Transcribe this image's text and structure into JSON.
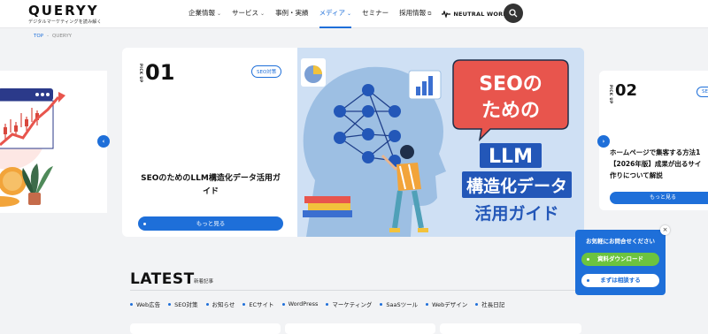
{
  "header": {
    "logo_name": "QUERYY",
    "logo_tagline": "デジタルマーケティングを読み解く",
    "nav": [
      {
        "label": "企業情報",
        "chevron": "⌄"
      },
      {
        "label": "サービス",
        "chevron": "⌄"
      },
      {
        "label": "事例・実績",
        "chevron": ""
      },
      {
        "label": "メディア",
        "chevron": "⌄"
      },
      {
        "label": "セミナー",
        "chevron": ""
      },
      {
        "label": "採用情報",
        "chevron": "⧉"
      }
    ],
    "neutral_works": "NEUTRAL WORKS"
  },
  "breadcrumb": {
    "top": "TOP",
    "separator": "-",
    "current": "QUERYY"
  },
  "pickup": {
    "main": {
      "up_label": "PICK UP",
      "number": "01",
      "tag": "SEO対策",
      "title": "SEOのためのLLM構造化データ活用ガイド",
      "more": "もっと見る",
      "hero": {
        "bubble_line1": "SEOの",
        "bubble_line2": "ための",
        "box_line1": "LLM",
        "box_line2": "構造化データ",
        "box_line3": "活用ガイド"
      }
    },
    "next": {
      "up_label": "PICK UP",
      "number": "02",
      "tag": "SEO",
      "title_line1": "ホームページで集客する方法1",
      "title_line2": "【2026年版】成果が出るサイ",
      "title_line3": "作りについて解説",
      "more": "もっと見る"
    },
    "prev_arrow": "‹",
    "next_arrow": "›"
  },
  "latest": {
    "heading": "LATEST",
    "sub": "新着記事",
    "categories": [
      "Web広告",
      "SEO対策",
      "お知らせ",
      "ECサイト",
      "WordPress",
      "マーケティング",
      "SaaSツール",
      "Webデザイン",
      "社長日記"
    ]
  },
  "contact": {
    "title": "お気軽にお問合せください",
    "download": "資料ダウンロード",
    "consult": "まずは相談する",
    "close": "×"
  },
  "colors": {
    "accent": "#1e6fd9",
    "green": "#6cc33f",
    "hero_bg": "#cfe0f4",
    "bubble_red": "#e8554d"
  }
}
